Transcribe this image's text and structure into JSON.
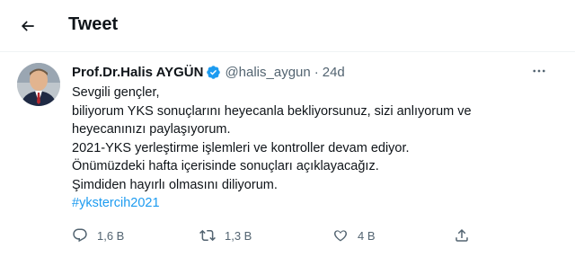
{
  "header": {
    "title": "Tweet",
    "back_icon": "arrow-left-icon"
  },
  "tweet": {
    "display_name": "Prof.Dr.Halis AYGÜN",
    "verified": true,
    "handle": "@halis_aygun",
    "separator": "·",
    "time": "24d",
    "lines": [
      "Sevgili gençler,",
      "biliyorum YKS sonuçlarını heyecanla bekliyorsunuz, sizi anlıyorum ve",
      "heyecanınızı paylaşıyorum.",
      "2021-YKS yerleştirme işlemleri ve kontroller devam ediyor.",
      "Önümüzdeki hafta içerisinde sonuçları açıklayacağız.",
      "Şimdiden hayırlı olmasını diliyorum."
    ],
    "hashtag": "#ykstercih2021"
  },
  "actions": {
    "replies": "1,6 B",
    "retweets": "1,3 B",
    "likes": "4 B"
  },
  "colors": {
    "accent": "#1d9bf0",
    "text": "#0f1419",
    "muted": "#536471"
  }
}
